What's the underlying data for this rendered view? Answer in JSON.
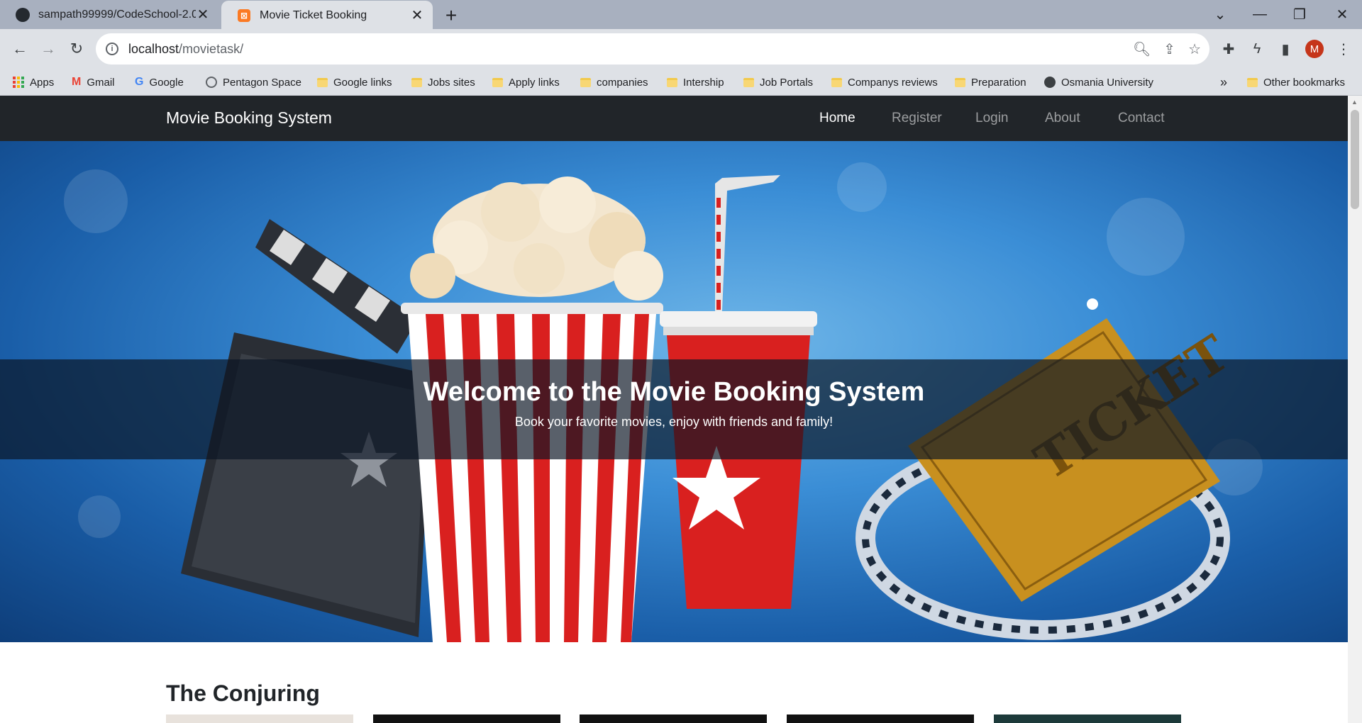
{
  "browser": {
    "tabs": [
      {
        "title": "sampath99999/CodeSchool-2.0-",
        "icon": "github-icon",
        "active": false
      },
      {
        "title": "Movie Ticket Booking",
        "icon": "xampp-icon",
        "active": true
      }
    ],
    "url_host": "localhost",
    "url_path": "/movietask/",
    "profile_initial": "M",
    "bookmarks": [
      {
        "label": "Apps",
        "icon": "apps-grid-icon"
      },
      {
        "label": "Gmail",
        "icon": "gmail-icon"
      },
      {
        "label": "Google",
        "icon": "google-icon"
      },
      {
        "label": "Pentagon Space",
        "icon": "pentagon-space-icon"
      },
      {
        "label": "Google links",
        "icon": "folder-icon"
      },
      {
        "label": "Jobs sites",
        "icon": "folder-icon"
      },
      {
        "label": "Apply links",
        "icon": "folder-icon"
      },
      {
        "label": "companies",
        "icon": "folder-icon"
      },
      {
        "label": "Intership",
        "icon": "folder-icon"
      },
      {
        "label": "Job Portals",
        "icon": "folder-icon"
      },
      {
        "label": "Companys reviews",
        "icon": "folder-icon"
      },
      {
        "label": "Preparation",
        "icon": "folder-icon"
      },
      {
        "label": "Osmania University",
        "icon": "globe-icon"
      }
    ],
    "bookmarks_overflow": "»",
    "other_bookmarks": "Other bookmarks"
  },
  "site": {
    "brand": "Movie Booking System",
    "nav": [
      "Home",
      "Register",
      "Login",
      "About",
      "Contact"
    ],
    "active_nav": "Home",
    "hero": {
      "title": "Welcome to the Movie Booking System",
      "subtitle": "Book your favorite movies, enjoy with friends and family!"
    },
    "section_title": "The Conjuring"
  },
  "colors": {
    "navbar_bg": "#212529",
    "hero_blue": "#3b8ed6",
    "accent_red": "#d9201f"
  }
}
